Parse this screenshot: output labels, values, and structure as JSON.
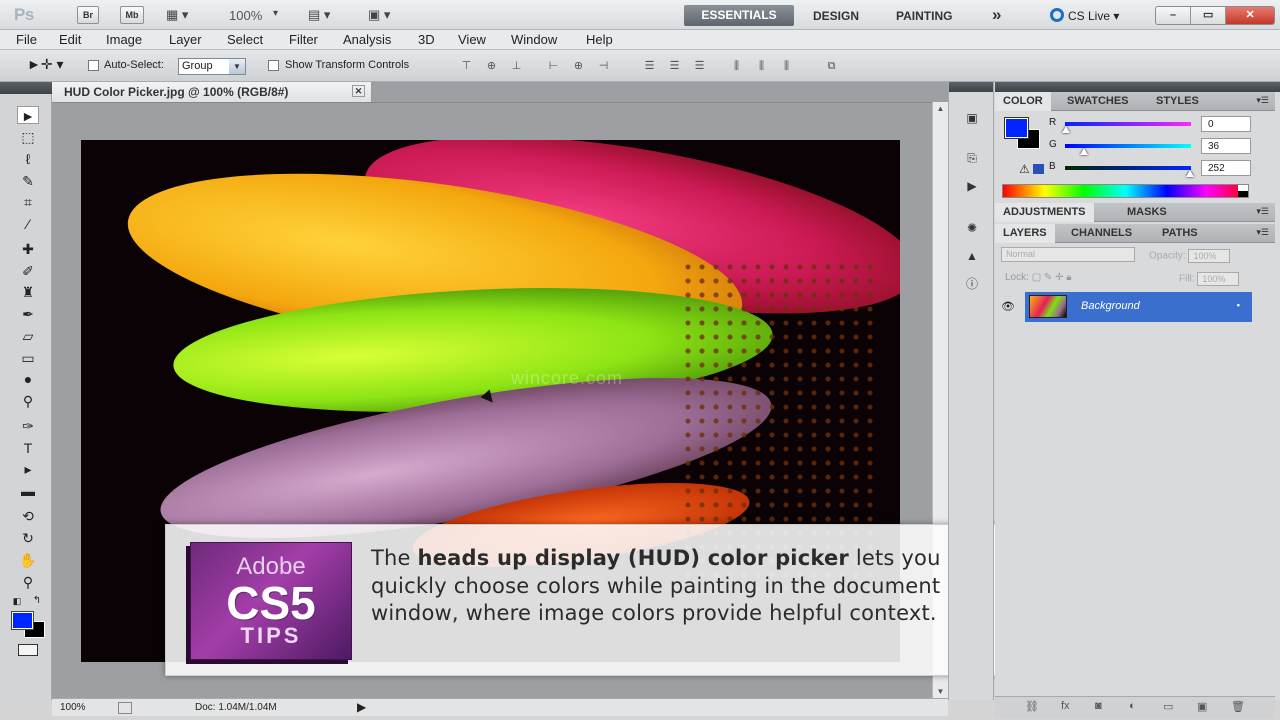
{
  "appbar": {
    "logo": "Ps",
    "bridge": "Br",
    "mini_bridge": "Mb",
    "zoom": "100%",
    "workspaces": [
      "ESSENTIALS",
      "DESIGN",
      "PAINTING"
    ],
    "more": "»",
    "cs_live": "CS Live",
    "window_controls": [
      "–",
      "▭",
      "✕"
    ]
  },
  "menus": [
    "File",
    "Edit",
    "Image",
    "Layer",
    "Select",
    "Filter",
    "Analysis",
    "3D",
    "View",
    "Window",
    "Help"
  ],
  "options": {
    "auto_select_label": "Auto-Select:",
    "auto_select_value": "Group",
    "show_transform_label": "Show Transform Controls"
  },
  "document": {
    "tab_title": "HUD Color Picker.jpg @ 100% (RGB/8#)",
    "watermark": "wincore.com"
  },
  "tip": {
    "logo_line1": "Adobe",
    "logo_line2": "CS5",
    "logo_line3": "TIPS",
    "text_before": "The ",
    "text_bold": "heads up display (HUD) color picker",
    "text_after": " lets you quickly choose colors while painting in the document window, where image colors provide helpful context."
  },
  "status": {
    "zoom": "100%",
    "doc_info": "Doc: 1.04M/1.04M"
  },
  "panels": {
    "color_tabs": [
      "COLOR",
      "SWATCHES",
      "STYLES"
    ],
    "rgb": [
      {
        "label": "R",
        "value": "0"
      },
      {
        "label": "G",
        "value": "36"
      },
      {
        "label": "B",
        "value": "252"
      }
    ],
    "adjust_tabs": [
      "ADJUSTMENTS",
      "MASKS"
    ],
    "layer_tabs": [
      "LAYERS",
      "CHANNELS",
      "PATHS"
    ],
    "blend_mode": "Normal",
    "opacity_label": "Opacity:",
    "opacity_value": "100%",
    "lock_label": "Lock:",
    "fill_label": "Fill:",
    "fill_value": "100%",
    "layer_name": "Background"
  },
  "colors": {
    "foreground": "#0026ff",
    "background": "#000000",
    "selected_layer": "#3a6fd0"
  }
}
